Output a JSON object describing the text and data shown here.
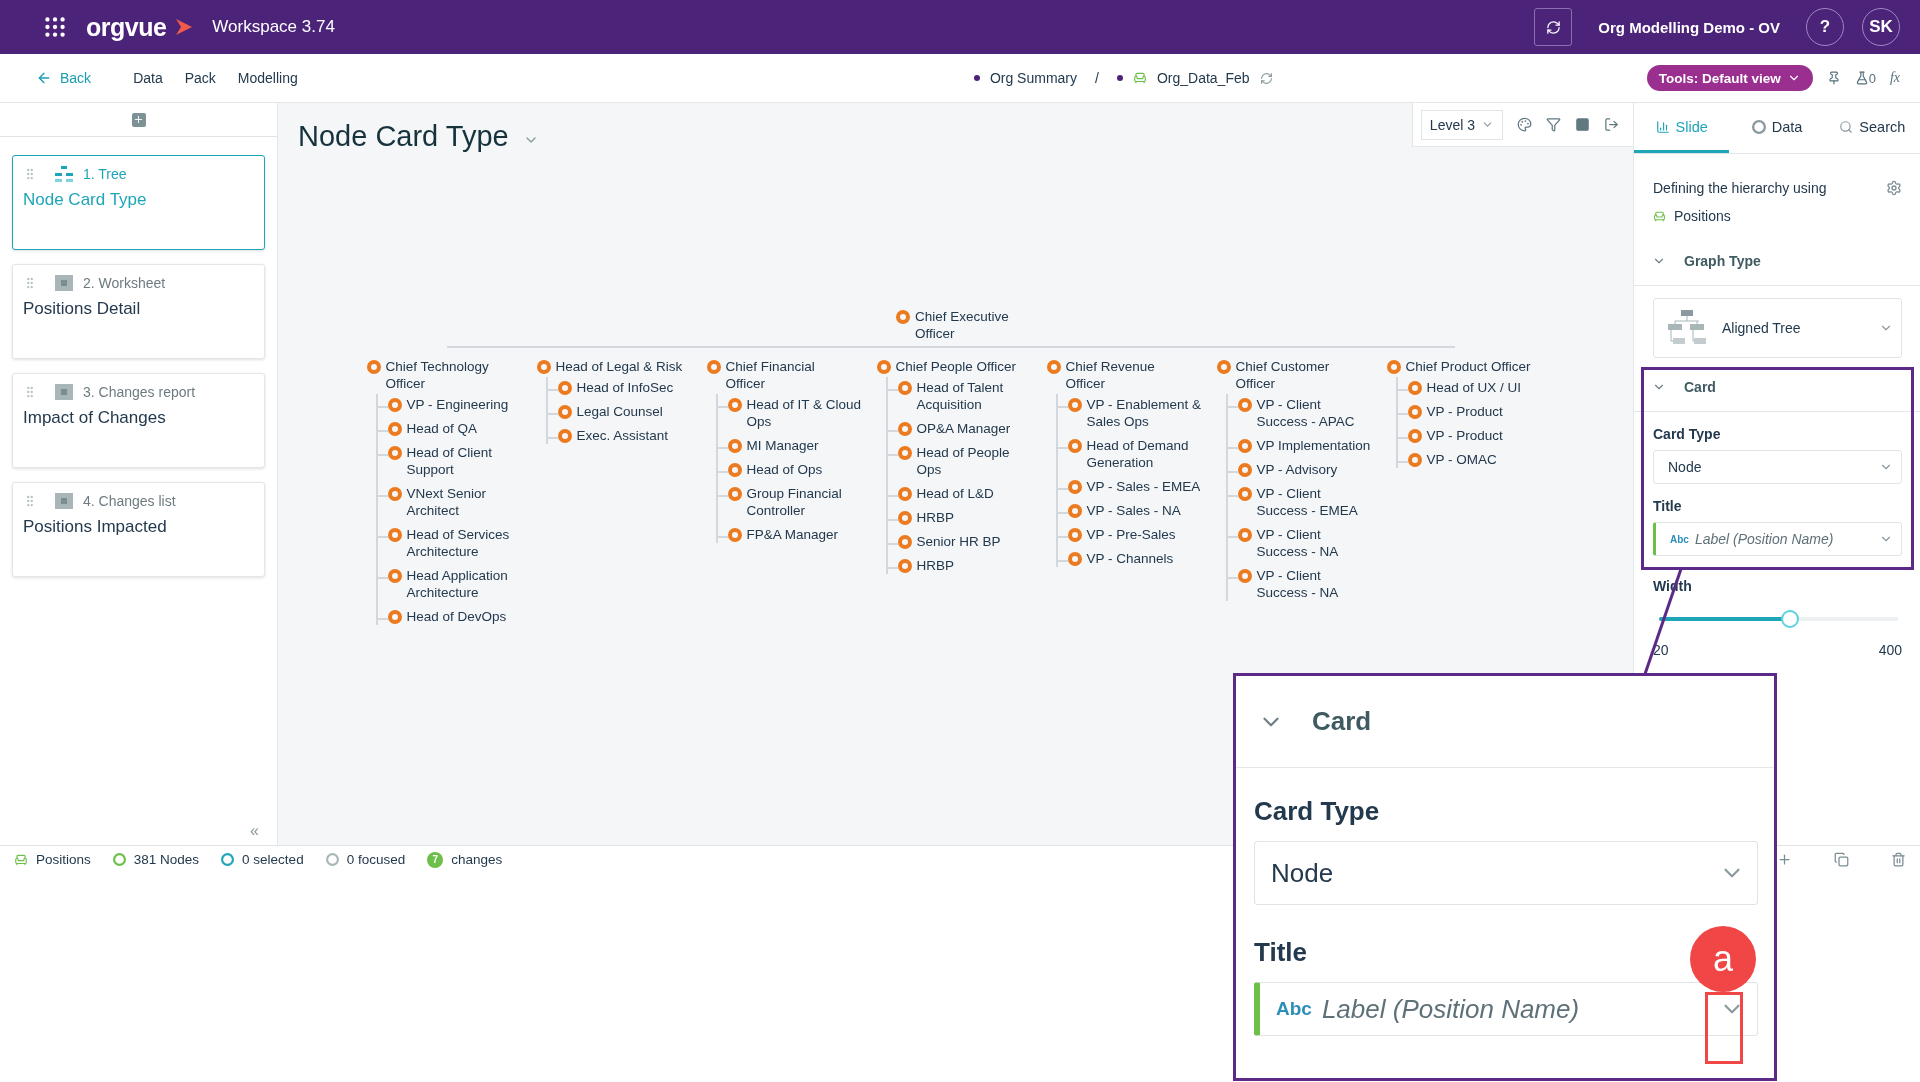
{
  "topbar": {
    "logo": "orgvue",
    "workspace": "Workspace 3.74",
    "project": "Org Modelling Demo - OV",
    "help": "?",
    "avatar": "SK"
  },
  "subbar": {
    "back": "Back",
    "menu": [
      "Data",
      "Pack",
      "Modelling"
    ],
    "breadcrumb": [
      "Org Summary",
      "/",
      "Org_Data_Feb"
    ],
    "tools": "Tools: Default view",
    "flask_count": "0",
    "fx": "fx"
  },
  "sidebar": {
    "cards": [
      {
        "kind": "tree",
        "label": "1. Tree",
        "title": "Node Card Type",
        "selected": true
      },
      {
        "kind": "sheet",
        "label": "2. Worksheet",
        "title": "Positions Detail",
        "selected": false
      },
      {
        "kind": "sheet",
        "label": "3. Changes report",
        "title": "Impact of Changes",
        "selected": false
      },
      {
        "kind": "sheet",
        "label": "4. Changes list",
        "title": "Positions Impacted",
        "selected": false
      }
    ],
    "collapse": "«"
  },
  "canvas": {
    "title": "Node Card Type",
    "level": "Level 3",
    "tree": {
      "label": "Chief Executive Officer",
      "children": [
        {
          "label": "Chief Technology Officer",
          "children": [
            {
              "label": "VP - Engineering"
            },
            {
              "label": "Head of QA"
            },
            {
              "label": "Head of Client Support"
            },
            {
              "label": "VNext Senior Architect"
            },
            {
              "label": "Head of Services Architecture"
            },
            {
              "label": "Head Application Architecture"
            },
            {
              "label": "Head of DevOps"
            }
          ]
        },
        {
          "label": "Head of Legal & Risk",
          "children": [
            {
              "label": "Head of InfoSec"
            },
            {
              "label": "Legal Counsel"
            },
            {
              "label": "Exec. Assistant"
            }
          ]
        },
        {
          "label": "Chief Financial Officer",
          "children": [
            {
              "label": "Head of IT & Cloud Ops"
            },
            {
              "label": "MI Manager"
            },
            {
              "label": "Head of Ops"
            },
            {
              "label": "Group Financial Controller"
            },
            {
              "label": "FP&A Manager"
            }
          ]
        },
        {
          "label": "Chief People Officer",
          "children": [
            {
              "label": "Head of Talent Acquisition"
            },
            {
              "label": "OP&A Manager"
            },
            {
              "label": "Head of People Ops"
            },
            {
              "label": "Head of L&D"
            },
            {
              "label": "HRBP"
            },
            {
              "label": "Senior HR BP"
            },
            {
              "label": "HRBP"
            }
          ]
        },
        {
          "label": "Chief Revenue Officer",
          "children": [
            {
              "label": "VP - Enablement & Sales Ops"
            },
            {
              "label": "Head of Demand Generation"
            },
            {
              "label": "VP - Sales - EMEA"
            },
            {
              "label": "VP - Sales - NA"
            },
            {
              "label": "VP - Pre-Sales"
            },
            {
              "label": "VP - Channels"
            }
          ]
        },
        {
          "label": "Chief Customer Officer",
          "children": [
            {
              "label": "VP - Client Success - APAC"
            },
            {
              "label": "VP Implementation"
            },
            {
              "label": "VP - Advisory"
            },
            {
              "label": "VP - Client Success - EMEA"
            },
            {
              "label": "VP - Client Success - NA"
            },
            {
              "label": "VP - Client Success - NA"
            }
          ]
        },
        {
          "label": "Chief Product Officer",
          "children": [
            {
              "label": "Head of UX / UI"
            },
            {
              "label": "VP - Product"
            },
            {
              "label": "VP - Product"
            },
            {
              "label": "VP - OMAC"
            }
          ]
        }
      ]
    }
  },
  "panel": {
    "tabs": [
      {
        "kind": "slide",
        "label": "Slide",
        "selected": true
      },
      {
        "kind": "data",
        "label": "Data",
        "selected": false
      },
      {
        "kind": "search",
        "label": "Search",
        "selected": false
      }
    ],
    "hierarchy_text": "Defining the hierarchy using",
    "hierarchy_value": "Positions",
    "graph_section": {
      "title": "Graph Type",
      "expanded": true,
      "value": "Aligned Tree"
    },
    "card_section": {
      "title": "Card",
      "expanded": true,
      "card_type_label": "Card Type",
      "card_type": "Node",
      "title_label": "Title",
      "title_tag": "Abc",
      "title_value": "Label (Position Name)"
    },
    "width": {
      "label": "Width",
      "level": 0.55,
      "min": "20",
      "max": "400"
    }
  },
  "status_bar": [
    {
      "kind": "chair",
      "text": "Positions"
    },
    {
      "kind": "nodes",
      "text": "381 Nodes"
    },
    {
      "kind": "selected",
      "text": "0 selected"
    },
    {
      "kind": "focused",
      "text": "0 focused"
    },
    {
      "kind": "changes",
      "count": "7",
      "text": "changes"
    }
  ],
  "callout": {
    "title": "Card",
    "expanded": true,
    "card_type_label": "Card Type",
    "card_type": "Node",
    "title_label": "Title",
    "title_tag": "Abc",
    "title_value": "Label (Position Name)",
    "badge": "a"
  }
}
